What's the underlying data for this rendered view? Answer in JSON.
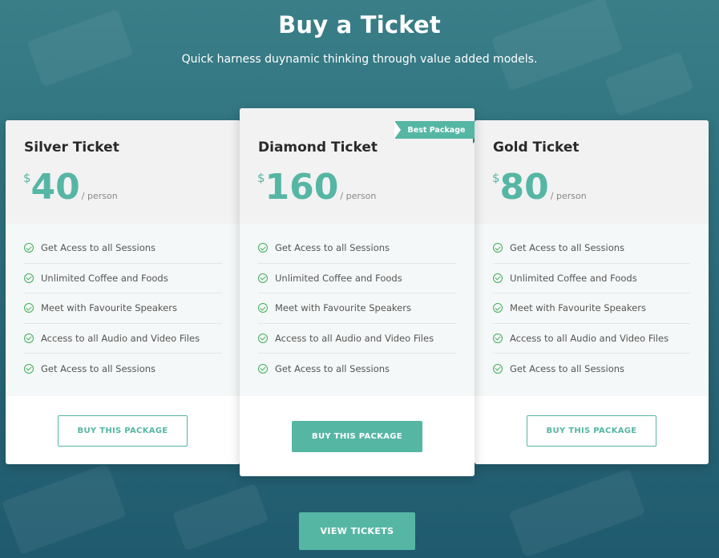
{
  "header": {
    "title": "Buy a Ticket",
    "subtitle": "Quick harness duynamic thinking through value added models."
  },
  "cards": [
    {
      "name": "Silver Ticket",
      "currency": "$",
      "amount": "40",
      "per": "/ person",
      "features": [
        "Get Acess to all Sessions",
        "Unlimited Coffee and Foods",
        "Meet with Favourite Speakers",
        "Access to all Audio and Video Files",
        "Get Acess to all Sessions"
      ],
      "button": "BUY THIS PACKAGE"
    },
    {
      "name": "Diamond Ticket",
      "currency": "$",
      "amount": "160",
      "per": "/ person",
      "badge": "Best Package",
      "features": [
        "Get Acess to all Sessions",
        "Unlimited Coffee and Foods",
        "Meet with Favourite Speakers",
        "Access to all Audio and Video Files",
        "Get Acess to all Sessions"
      ],
      "button": "BUY THIS PACKAGE"
    },
    {
      "name": "Gold Ticket",
      "currency": "$",
      "amount": "80",
      "per": "/ person",
      "features": [
        "Get Acess to all Sessions",
        "Unlimited Coffee and Foods",
        "Meet with Favourite Speakers",
        "Access to all Audio and Video Files",
        "Get Acess to all Sessions"
      ],
      "button": "BUY THIS PACKAGE"
    }
  ],
  "view_button": "VIEW TICKETS",
  "colors": {
    "accent": "#56b6a4",
    "check": "#3fae5a",
    "background": "#2f7480"
  },
  "icons": {
    "feature": "check-circle-icon"
  }
}
